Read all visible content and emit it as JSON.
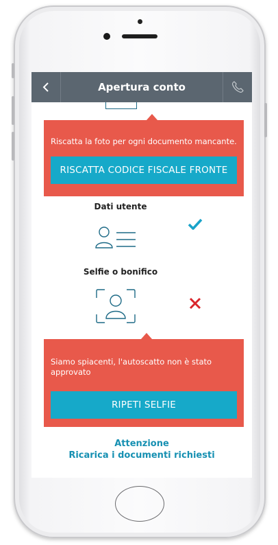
{
  "header": {
    "title": "Apertura conto",
    "back_icon": "chevron-left-icon",
    "call_icon": "phone-icon"
  },
  "alerts": {
    "document": {
      "message": "Riscatta la foto per ogni documento mancante.",
      "button": "RISCATTA CODICE FISCALE FRONTE"
    },
    "selfie": {
      "message": "Siamo spiacenti, l'autoscatto non è stato approvato",
      "button": "RIPETI SELFIE"
    }
  },
  "steps": [
    {
      "label": "Dati utente",
      "icon": "user-data-icon",
      "status": "completed"
    },
    {
      "label": "Selfie o bonifico",
      "icon": "selfie-icon",
      "status": "failed"
    }
  ],
  "footer": {
    "title": "Attenzione",
    "subtitle": "Ricarica i documenti richiesti"
  },
  "colors": {
    "header_bg": "#5b6670",
    "alert_bg": "#e8594b",
    "button_bg": "#16a9c9",
    "success": "#1aa3c9",
    "error": "#d9252b",
    "accent_text": "#1690b2"
  }
}
